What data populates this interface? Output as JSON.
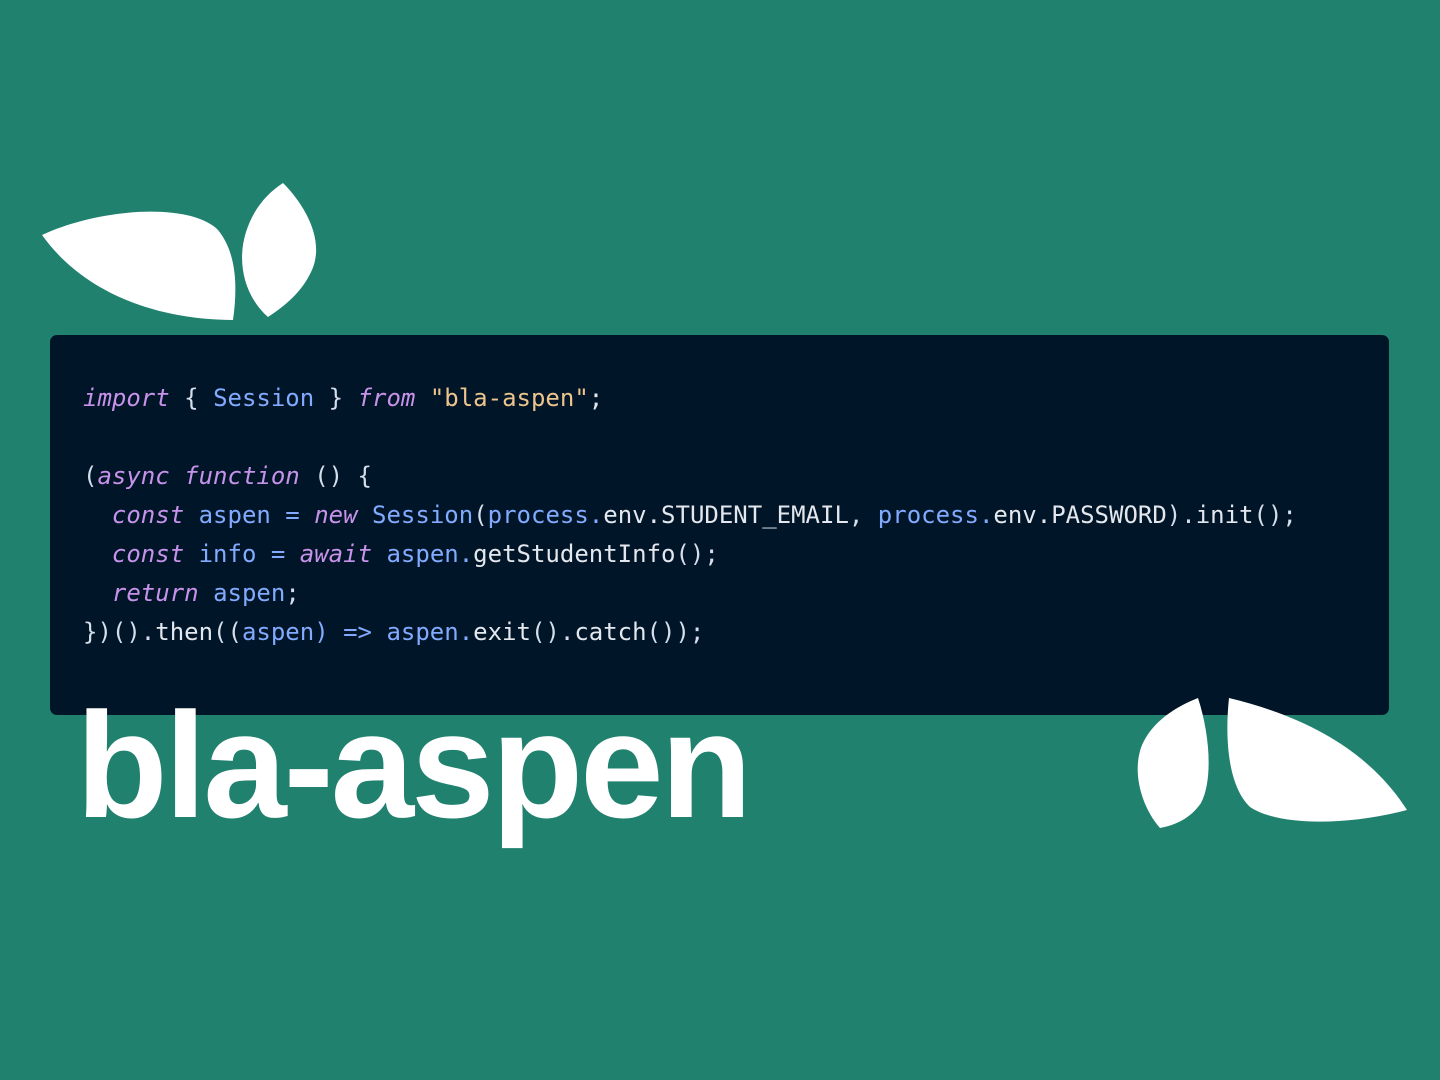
{
  "brand": {
    "title": "bla-aspen"
  },
  "colors": {
    "background": "#21816f",
    "code_background": "#001628",
    "keyword": "#c792ea",
    "identifier": "#82aaff",
    "string": "#ecc48d",
    "text": "#e4e8ee"
  },
  "icons": {
    "top_left": "leaf-pair-icon",
    "bottom_right": "leaf-pair-icon"
  },
  "code": {
    "line1": {
      "kw_import": "import",
      "brace_open": " { ",
      "id_session": "Session",
      "brace_close": " } ",
      "kw_from": "from",
      "space": " ",
      "str_module": "\"bla-aspen\"",
      "semicolon": ";"
    },
    "line3": {
      "paren": "(",
      "kw_async": "async",
      "space1": " ",
      "kw_function": "function",
      "rest": " () {"
    },
    "line4": {
      "indent": "  ",
      "kw_const": "const",
      "space1": " ",
      "id_aspen": "aspen",
      "eq": " = ",
      "kw_new": "new",
      "space2": " ",
      "id_session": "Session",
      "paren_open": "(",
      "id_process1": "process",
      "dot1": ".",
      "env1": "env.STUDENT_EMAIL",
      "comma": ", ",
      "id_process2": "process",
      "dot2": ".",
      "env2": "env.PASSWORD",
      "paren_close": ").",
      "init": "init",
      "end": "();"
    },
    "line5": {
      "indent": "  ",
      "kw_const": "const",
      "space1": " ",
      "id_info": "info",
      "eq": " = ",
      "kw_await": "await",
      "space2": " ",
      "id_aspen": "aspen",
      "dot": ".",
      "method": "getStudentInfo",
      "end": "();"
    },
    "line6": {
      "indent": "  ",
      "kw_return": "return",
      "space": " ",
      "id_aspen": "aspen",
      "end": ";"
    },
    "line7": {
      "start": "})().",
      "then": "then",
      "paren": "((",
      "id_aspen1": "aspen",
      "arrow": ") => ",
      "id_aspen2": "aspen",
      "dot": ".",
      "exit": "exit",
      "mid": "().",
      "catch": "catch",
      "end": "());"
    }
  }
}
